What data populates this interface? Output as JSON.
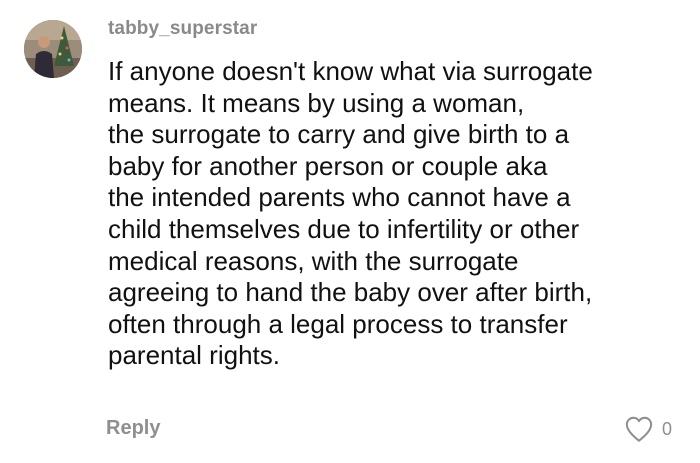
{
  "comment": {
    "username": "tabby_superstar",
    "avatar_icon": "avatar-christmas-tree-photo",
    "text_lines": [
      "If anyone doesn't know what via surrogate",
      "means. It means by using a woman,",
      "the surrogate to carry and give birth to a",
      "baby for another person or couple aka",
      "the intended parents who cannot have a",
      "child themselves due to infertility or other",
      "medical reasons, with the surrogate",
      "agreeing to hand the baby over after birth,",
      "often through a legal process to transfer",
      "parental rights."
    ],
    "reply_label": "Reply",
    "like_icon": "heart-outline-icon",
    "like_count": "0"
  },
  "colors": {
    "username": "#8a8a8a",
    "text": "#111111",
    "muted": "#8f8f8f",
    "background": "#ffffff"
  }
}
